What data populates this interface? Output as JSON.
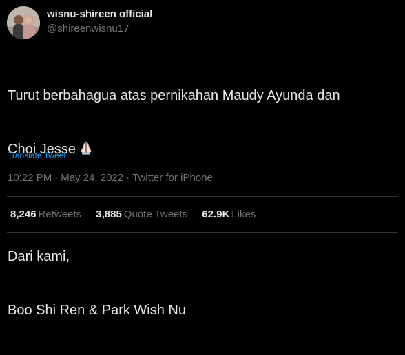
{
  "user": {
    "display_name": "wisnu-shireen official",
    "handle": "@shireenwisnu17",
    "avatar_icon": "profile-photo-couple"
  },
  "tweet": {
    "lines": [
      "Turut berbahagua atas pernikahan Maudy Ayunda dan",
      "Choi Jesse",
      "",
      "Dari kami,",
      "Boo Shi Ren & Park Wish Nu"
    ],
    "emoji_icon": "folded-hands-icon",
    "translate_label": "Translate Tweet"
  },
  "meta": {
    "time": "10:22 PM",
    "date": "May 24, 2022",
    "source": "Twitter for iPhone",
    "separator": "·"
  },
  "stats": {
    "retweets_count": "8,246",
    "retweets_label": "Retweets",
    "quotes_count": "3,885",
    "quotes_label": "Quote Tweets",
    "likes_count": "62.9K",
    "likes_label": "Likes"
  },
  "colors": {
    "background": "#000000",
    "text_primary": "#e7e9ea",
    "text_secondary": "#71767b",
    "link": "#1d9bf0",
    "divider": "#2f3336"
  }
}
